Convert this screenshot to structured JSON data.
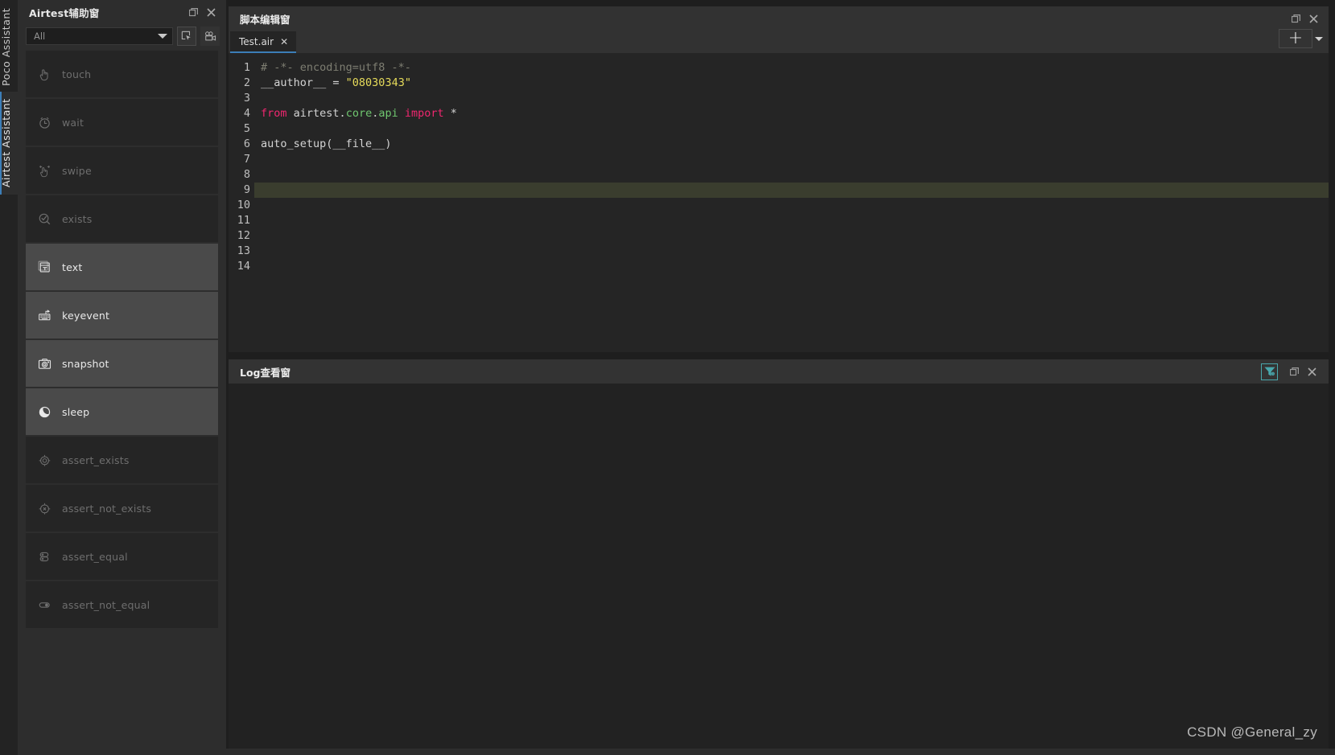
{
  "vertical_tabs": [
    {
      "label": "Poco Assistant",
      "active": false
    },
    {
      "label": "Airtest Assistant",
      "active": true
    }
  ],
  "left_panel": {
    "title": "Airtest辅助窗",
    "window_controls": [
      {
        "name": "restore-icon",
        "glyph": "restore"
      },
      {
        "name": "close-icon",
        "glyph": "close"
      }
    ],
    "filter_combo": {
      "value": "All",
      "placeholder": "All"
    },
    "toolbar_buttons": [
      {
        "name": "screenshot-select-button",
        "tooltip": "screenshot-select-icon"
      },
      {
        "name": "record-button",
        "tooltip": "record-camera-icon"
      }
    ],
    "commands": [
      {
        "label": "touch",
        "icon": "hand-touch-icon",
        "enabled": false
      },
      {
        "label": "wait",
        "icon": "clock-icon",
        "enabled": false
      },
      {
        "label": "swipe",
        "icon": "hand-swipe-icon",
        "enabled": false
      },
      {
        "label": "exists",
        "icon": "check-circle-icon",
        "enabled": false
      },
      {
        "label": "text",
        "icon": "text-input-icon",
        "enabled": true
      },
      {
        "label": "keyevent",
        "icon": "keyboard-icon",
        "enabled": true
      },
      {
        "label": "snapshot",
        "icon": "camera-icon",
        "enabled": true
      },
      {
        "label": "sleep",
        "icon": "moon-icon",
        "enabled": true
      },
      {
        "label": "assert_exists",
        "icon": "target-icon",
        "enabled": false
      },
      {
        "label": "assert_not_exists",
        "icon": "target-x-icon",
        "enabled": false
      },
      {
        "label": "assert_equal",
        "icon": "equal-stack-icon",
        "enabled": false
      },
      {
        "label": "assert_not_equal",
        "icon": "not-equal-stack-icon",
        "enabled": false
      }
    ]
  },
  "editor": {
    "title": "脚本编辑窗",
    "window_controls": [
      {
        "name": "restore-icon",
        "glyph": "restore"
      },
      {
        "name": "close-icon",
        "glyph": "close"
      }
    ],
    "tabs": [
      {
        "label": "Test.air",
        "active": true,
        "close_label": "✕"
      }
    ],
    "add_button_label": "+",
    "current_line": 9,
    "line_numbers": [
      1,
      2,
      3,
      4,
      5,
      6,
      7,
      8,
      9,
      10,
      11,
      12,
      13,
      14
    ],
    "lines": [
      {
        "n": 1,
        "tokens": [
          {
            "t": "# -*- encoding=utf8 -*-",
            "c": "tok-com"
          }
        ]
      },
      {
        "n": 2,
        "tokens": [
          {
            "t": "__author__ = ",
            "c": "tok-pl"
          },
          {
            "t": "\"08030343\"",
            "c": "tok-str"
          }
        ]
      },
      {
        "n": 3,
        "tokens": []
      },
      {
        "n": 4,
        "tokens": [
          {
            "t": "from ",
            "c": "tok-kw"
          },
          {
            "t": "airtest",
            "c": "tok-mod"
          },
          {
            "t": ".",
            "c": "tok-pl"
          },
          {
            "t": "core",
            "c": "tok-attr"
          },
          {
            "t": ".",
            "c": "tok-pl"
          },
          {
            "t": "api ",
            "c": "tok-attr"
          },
          {
            "t": "import ",
            "c": "tok-kw"
          },
          {
            "t": "*",
            "c": "tok-pl"
          }
        ]
      },
      {
        "n": 5,
        "tokens": []
      },
      {
        "n": 6,
        "tokens": [
          {
            "t": "auto_setup(__file__)",
            "c": "tok-pl"
          }
        ]
      },
      {
        "n": 7,
        "tokens": []
      },
      {
        "n": 8,
        "tokens": []
      },
      {
        "n": 9,
        "tokens": []
      },
      {
        "n": 10,
        "tokens": []
      },
      {
        "n": 11,
        "tokens": []
      },
      {
        "n": 12,
        "tokens": []
      },
      {
        "n": 13,
        "tokens": []
      },
      {
        "n": 14,
        "tokens": []
      }
    ]
  },
  "log_panel": {
    "title": "Log查看窗",
    "filter_button": {
      "name": "filter-icon",
      "active": true,
      "color": "#49a7ac"
    },
    "window_controls": [
      {
        "name": "restore-icon",
        "glyph": "restore"
      },
      {
        "name": "close-icon",
        "glyph": "close"
      }
    ],
    "content": ""
  },
  "watermark": "CSDN @General_zy",
  "colors": {
    "accent_blue": "#3c7eb8",
    "accent_teal": "#49a7ac",
    "bg_window": "#1e1e1e",
    "bg_panel": "#2d2d2d",
    "bg_editor": "#252525",
    "bg_log": "#222222",
    "current_line": "#3a3d2e",
    "string": "#e6db5a",
    "keyword": "#f0266f",
    "comment": "#7e7e72",
    "function": "#6fc66f"
  }
}
